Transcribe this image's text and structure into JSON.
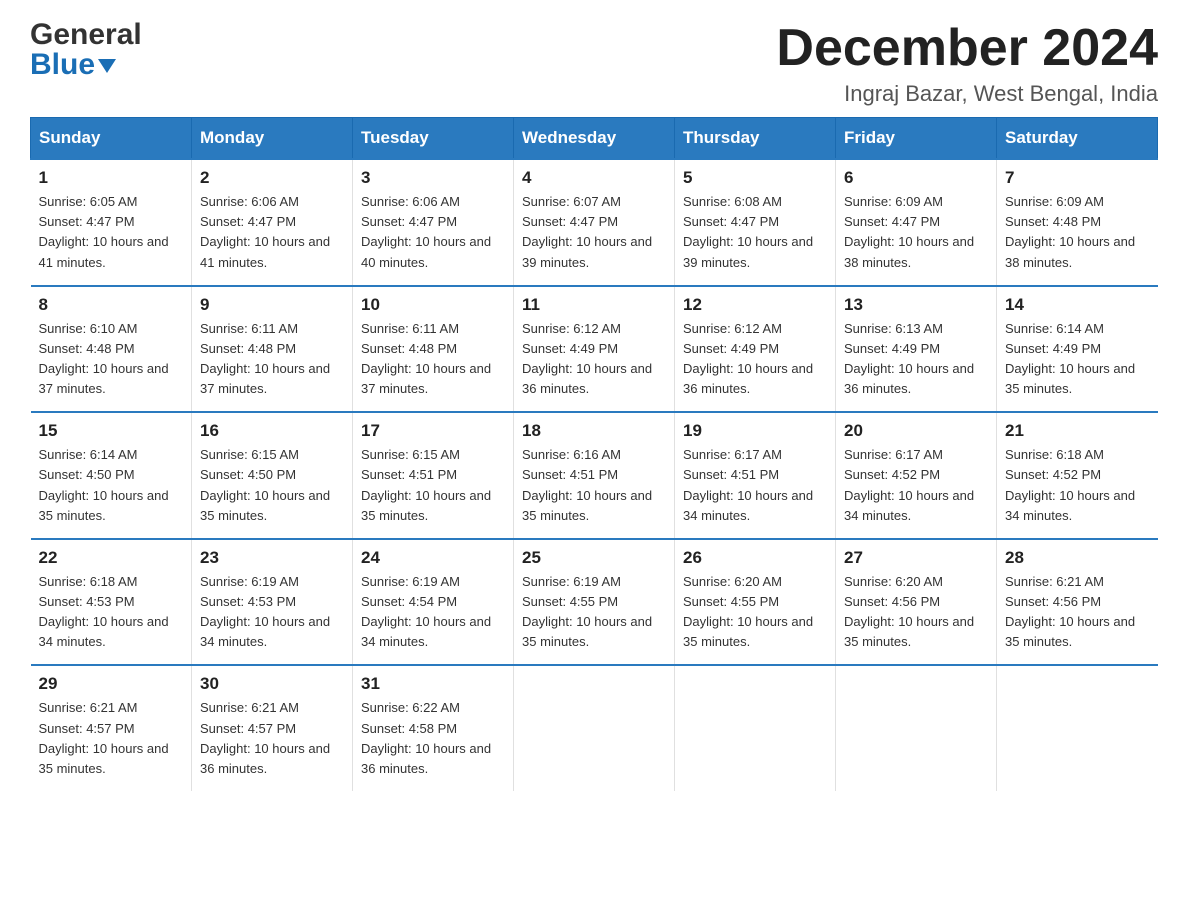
{
  "header": {
    "logo_line1": "General",
    "logo_line2": "Blue",
    "month_year": "December 2024",
    "location": "Ingraj Bazar, West Bengal, India"
  },
  "days_of_week": [
    "Sunday",
    "Monday",
    "Tuesday",
    "Wednesday",
    "Thursday",
    "Friday",
    "Saturday"
  ],
  "weeks": [
    [
      {
        "day": "1",
        "sunrise": "6:05 AM",
        "sunset": "4:47 PM",
        "daylight": "10 hours and 41 minutes."
      },
      {
        "day": "2",
        "sunrise": "6:06 AM",
        "sunset": "4:47 PM",
        "daylight": "10 hours and 41 minutes."
      },
      {
        "day": "3",
        "sunrise": "6:06 AM",
        "sunset": "4:47 PM",
        "daylight": "10 hours and 40 minutes."
      },
      {
        "day": "4",
        "sunrise": "6:07 AM",
        "sunset": "4:47 PM",
        "daylight": "10 hours and 39 minutes."
      },
      {
        "day": "5",
        "sunrise": "6:08 AM",
        "sunset": "4:47 PM",
        "daylight": "10 hours and 39 minutes."
      },
      {
        "day": "6",
        "sunrise": "6:09 AM",
        "sunset": "4:47 PM",
        "daylight": "10 hours and 38 minutes."
      },
      {
        "day": "7",
        "sunrise": "6:09 AM",
        "sunset": "4:48 PM",
        "daylight": "10 hours and 38 minutes."
      }
    ],
    [
      {
        "day": "8",
        "sunrise": "6:10 AM",
        "sunset": "4:48 PM",
        "daylight": "10 hours and 37 minutes."
      },
      {
        "day": "9",
        "sunrise": "6:11 AM",
        "sunset": "4:48 PM",
        "daylight": "10 hours and 37 minutes."
      },
      {
        "day": "10",
        "sunrise": "6:11 AM",
        "sunset": "4:48 PM",
        "daylight": "10 hours and 37 minutes."
      },
      {
        "day": "11",
        "sunrise": "6:12 AM",
        "sunset": "4:49 PM",
        "daylight": "10 hours and 36 minutes."
      },
      {
        "day": "12",
        "sunrise": "6:12 AM",
        "sunset": "4:49 PM",
        "daylight": "10 hours and 36 minutes."
      },
      {
        "day": "13",
        "sunrise": "6:13 AM",
        "sunset": "4:49 PM",
        "daylight": "10 hours and 36 minutes."
      },
      {
        "day": "14",
        "sunrise": "6:14 AM",
        "sunset": "4:49 PM",
        "daylight": "10 hours and 35 minutes."
      }
    ],
    [
      {
        "day": "15",
        "sunrise": "6:14 AM",
        "sunset": "4:50 PM",
        "daylight": "10 hours and 35 minutes."
      },
      {
        "day": "16",
        "sunrise": "6:15 AM",
        "sunset": "4:50 PM",
        "daylight": "10 hours and 35 minutes."
      },
      {
        "day": "17",
        "sunrise": "6:15 AM",
        "sunset": "4:51 PM",
        "daylight": "10 hours and 35 minutes."
      },
      {
        "day": "18",
        "sunrise": "6:16 AM",
        "sunset": "4:51 PM",
        "daylight": "10 hours and 35 minutes."
      },
      {
        "day": "19",
        "sunrise": "6:17 AM",
        "sunset": "4:51 PM",
        "daylight": "10 hours and 34 minutes."
      },
      {
        "day": "20",
        "sunrise": "6:17 AM",
        "sunset": "4:52 PM",
        "daylight": "10 hours and 34 minutes."
      },
      {
        "day": "21",
        "sunrise": "6:18 AM",
        "sunset": "4:52 PM",
        "daylight": "10 hours and 34 minutes."
      }
    ],
    [
      {
        "day": "22",
        "sunrise": "6:18 AM",
        "sunset": "4:53 PM",
        "daylight": "10 hours and 34 minutes."
      },
      {
        "day": "23",
        "sunrise": "6:19 AM",
        "sunset": "4:53 PM",
        "daylight": "10 hours and 34 minutes."
      },
      {
        "day": "24",
        "sunrise": "6:19 AM",
        "sunset": "4:54 PM",
        "daylight": "10 hours and 34 minutes."
      },
      {
        "day": "25",
        "sunrise": "6:19 AM",
        "sunset": "4:55 PM",
        "daylight": "10 hours and 35 minutes."
      },
      {
        "day": "26",
        "sunrise": "6:20 AM",
        "sunset": "4:55 PM",
        "daylight": "10 hours and 35 minutes."
      },
      {
        "day": "27",
        "sunrise": "6:20 AM",
        "sunset": "4:56 PM",
        "daylight": "10 hours and 35 minutes."
      },
      {
        "day": "28",
        "sunrise": "6:21 AM",
        "sunset": "4:56 PM",
        "daylight": "10 hours and 35 minutes."
      }
    ],
    [
      {
        "day": "29",
        "sunrise": "6:21 AM",
        "sunset": "4:57 PM",
        "daylight": "10 hours and 35 minutes."
      },
      {
        "day": "30",
        "sunrise": "6:21 AM",
        "sunset": "4:57 PM",
        "daylight": "10 hours and 36 minutes."
      },
      {
        "day": "31",
        "sunrise": "6:22 AM",
        "sunset": "4:58 PM",
        "daylight": "10 hours and 36 minutes."
      },
      null,
      null,
      null,
      null
    ]
  ],
  "labels": {
    "sunrise_prefix": "Sunrise: ",
    "sunset_prefix": "Sunset: ",
    "daylight_prefix": "Daylight: "
  }
}
